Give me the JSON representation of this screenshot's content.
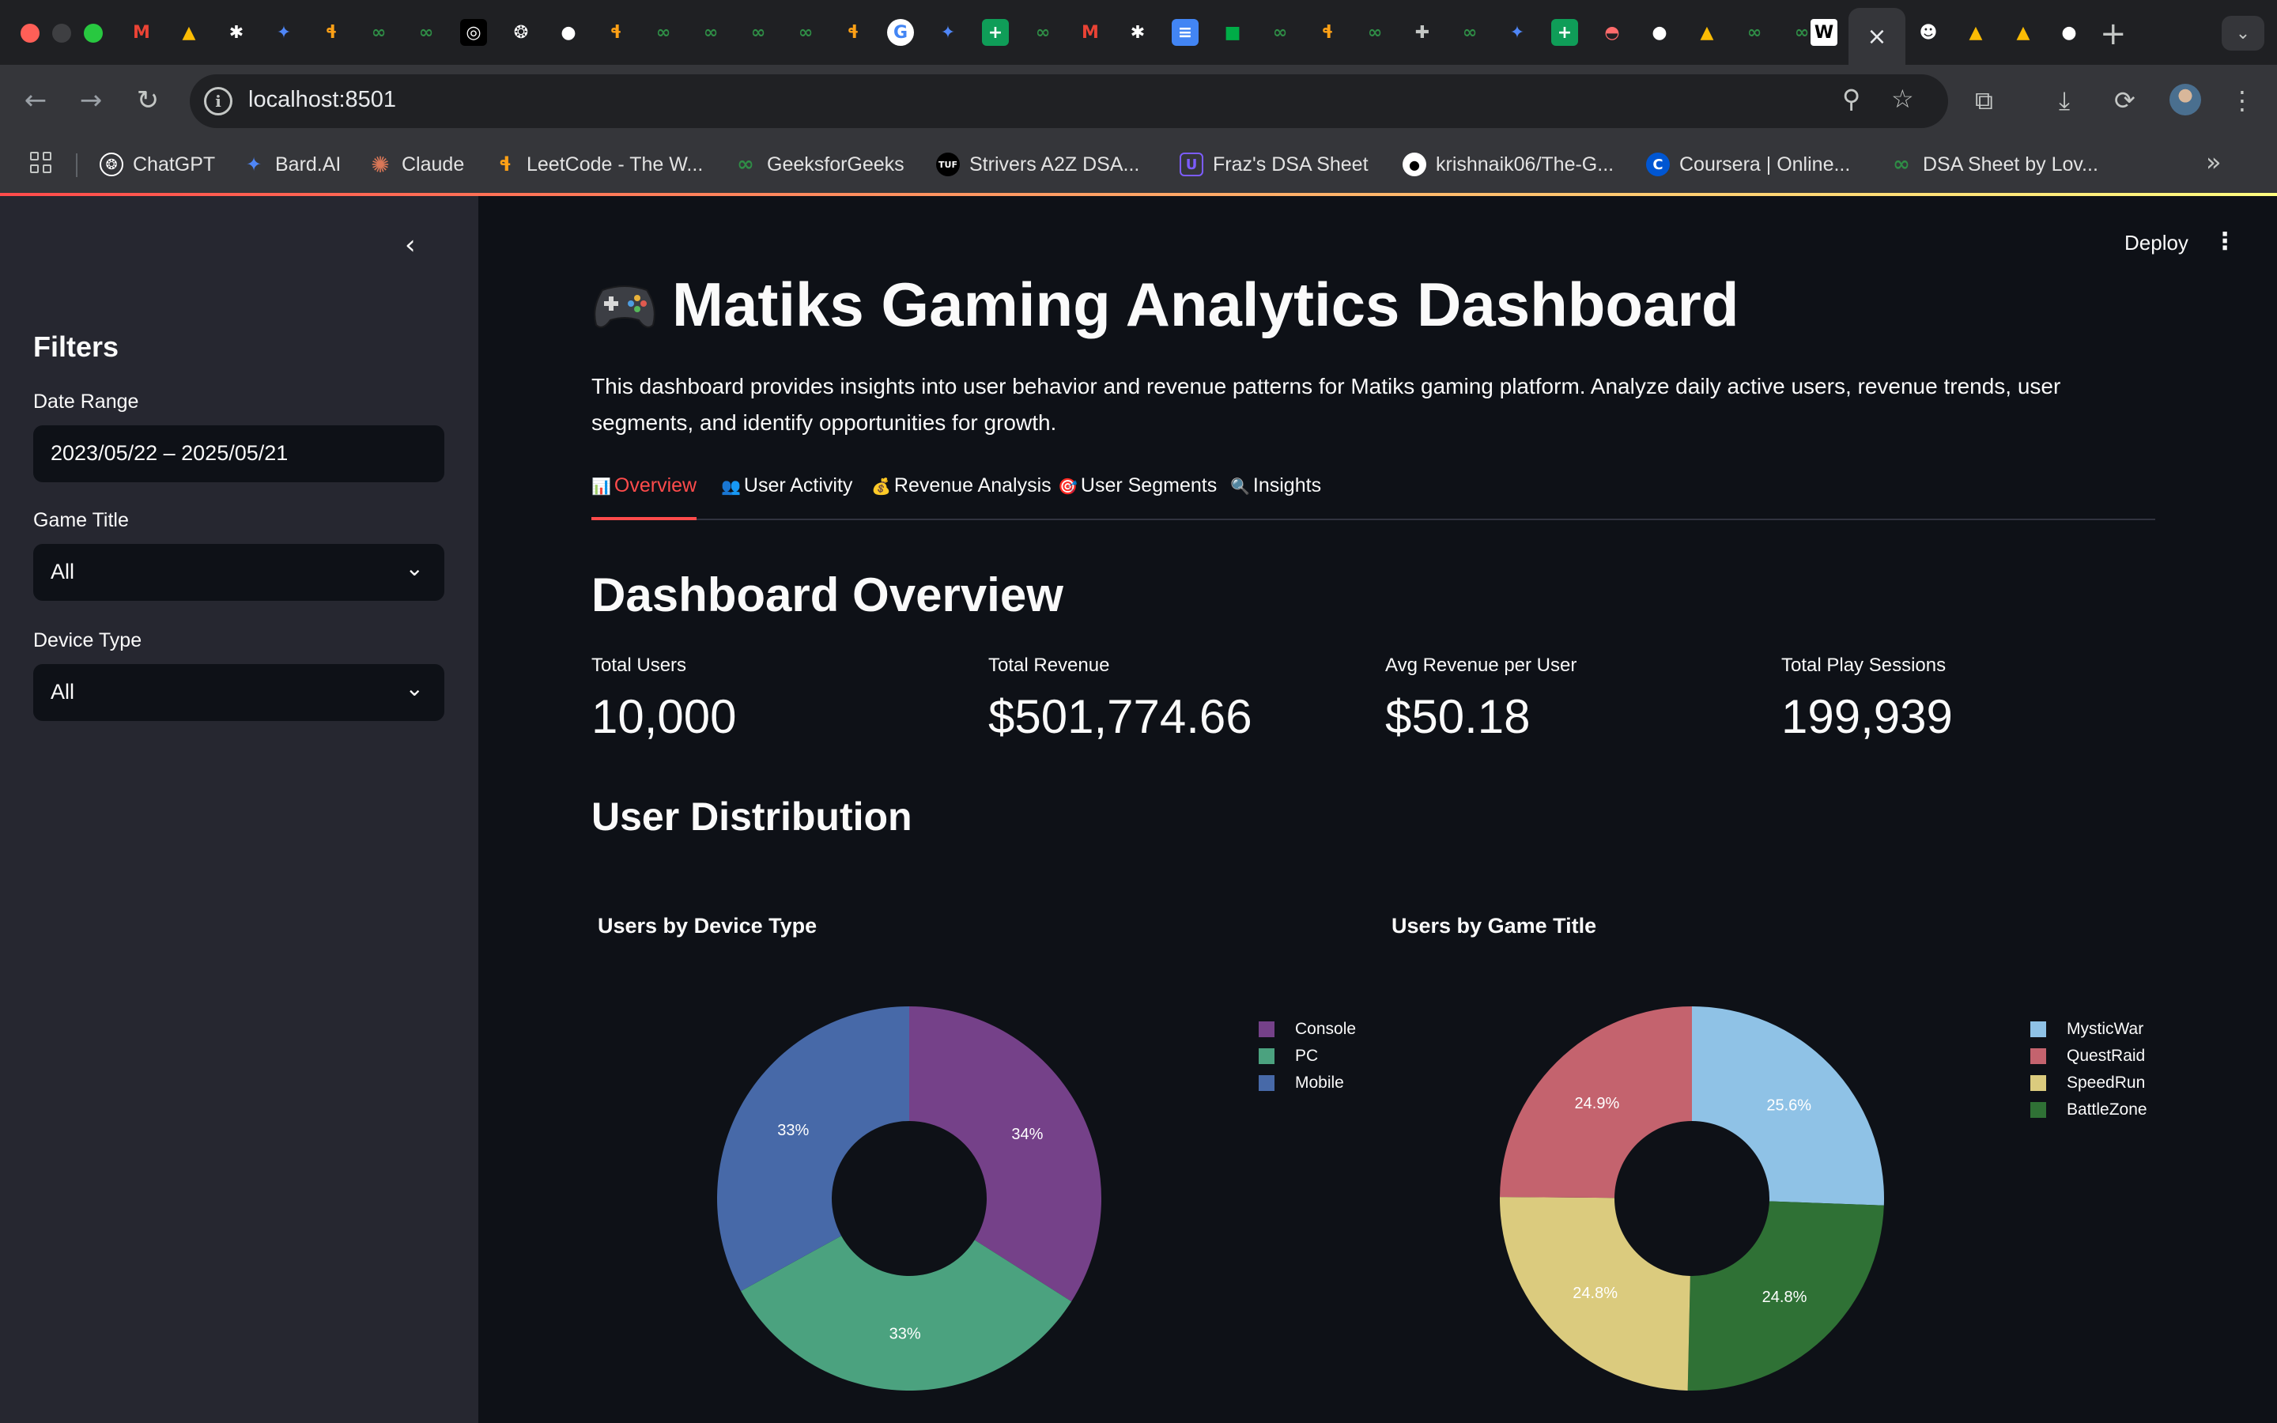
{
  "browser": {
    "url": "localhost:8501",
    "active_tab_close": "×",
    "bookmarks": [
      {
        "label": "ChatGPT",
        "icon": "chatgpt-icon",
        "color": "#ffffff"
      },
      {
        "label": "Bard.AI",
        "icon": "gemini-icon",
        "color": "#4f86f7"
      },
      {
        "label": "Claude",
        "icon": "claude-icon",
        "color": "#d97757"
      },
      {
        "label": "LeetCode - The W...",
        "icon": "leetcode-icon",
        "color": "#ffa116"
      },
      {
        "label": "GeeksforGeeks",
        "icon": "gfg-icon",
        "color": "#2f8d46"
      },
      {
        "label": "Strivers A2Z DSA...",
        "icon": "tuf-icon",
        "color": "#111111"
      },
      {
        "label": "Fraz's DSA Sheet",
        "icon": "fraz-icon",
        "color": "#7c5cff"
      },
      {
        "label": "krishnaik06/The-G...",
        "icon": "github-icon",
        "color": "#ffffff"
      },
      {
        "label": "Coursera | Online...",
        "icon": "coursera-icon",
        "color": "#0056d2"
      },
      {
        "label": "DSA Sheet by Lov...",
        "icon": "gfg-icon",
        "color": "#2f8d46"
      }
    ]
  },
  "sidebar": {
    "title": "Filters",
    "date_label": "Date Range",
    "date_value": "2023/05/22 – 2025/05/21",
    "game_label": "Game Title",
    "game_value": "All",
    "device_label": "Device Type",
    "device_value": "All"
  },
  "header": {
    "deploy": "Deploy"
  },
  "main": {
    "title": "Matiks Gaming Analytics Dashboard",
    "intro": "This dashboard provides insights into user behavior and revenue patterns for Matiks gaming platform. Analyze daily active users, revenue trends, user segments, and identify opportunities for growth.",
    "tabs": [
      {
        "icon": "📊",
        "label": "Overview"
      },
      {
        "icon": "👥",
        "label": "User Activity"
      },
      {
        "icon": "💰",
        "label": "Revenue Analysis"
      },
      {
        "icon": "🎯",
        "label": "User Segments"
      },
      {
        "icon": "🔍",
        "label": "Insights"
      }
    ],
    "overview_heading": "Dashboard Overview",
    "metrics": [
      {
        "label": "Total Users",
        "value": "10,000"
      },
      {
        "label": "Total Revenue",
        "value": "$501,774.66"
      },
      {
        "label": "Avg Revenue per User",
        "value": "$50.18"
      },
      {
        "label": "Total Play Sessions",
        "value": "199,939"
      }
    ],
    "distribution_heading": "User Distribution"
  },
  "chart_data": [
    {
      "type": "pie",
      "title": "Users by Device Type",
      "hole": true,
      "labels": [
        "Console",
        "PC",
        "Mobile"
      ],
      "values": [
        34,
        33,
        33
      ],
      "text_labels": [
        "34%",
        "33%",
        "33%"
      ],
      "colors": [
        "#754189",
        "#4ba27f",
        "#4769a8"
      ],
      "legend_position": "top-right"
    },
    {
      "type": "pie",
      "title": "Users by Game Title",
      "hole": true,
      "labels": [
        "MysticWar",
        "QuestRaid",
        "SpeedRun",
        "BattleZone"
      ],
      "values": [
        25.6,
        24.9,
        24.8,
        24.8
      ],
      "slice_order": [
        "MysticWar",
        "BattleZone",
        "SpeedRun",
        "QuestRaid"
      ],
      "text_labels": {
        "MysticWar": "25.6%",
        "QuestRaid": "24.9%",
        "SpeedRun": "24.8%",
        "BattleZone": "24.8%"
      },
      "colors": {
        "MysticWar": "#8fc2e6",
        "QuestRaid": "#c4636e",
        "SpeedRun": "#dbcb7e",
        "BattleZone": "#2f7135"
      },
      "legend_position": "top-right"
    }
  ]
}
